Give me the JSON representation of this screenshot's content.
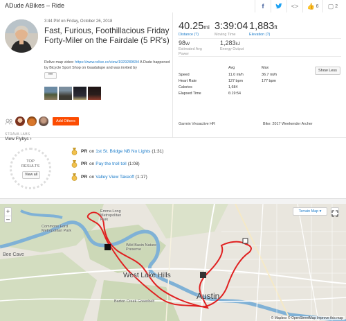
{
  "header": {
    "title": "ADude ABikes – Ride"
  },
  "share": {
    "kudos_count": "6",
    "comments_count": "2"
  },
  "activity": {
    "datetime": "3:44 PM on Friday, October 26, 2018",
    "title": "Fast, Furious, Foothillacious Friday Forty-Miler on the Fairdale (5 PR's)",
    "description_prefix": "Relive map video: ",
    "description_link": "https://www.relive.cc/view/1929289694",
    "description_suffix": " A Dude happened by Bicycle Sport Shop on Guadalupe and was invited by",
    "more_label": "•••",
    "add_others_label": "Add Others",
    "flyby_label": "STRAVA LABS",
    "flyby_link": "View Flybys"
  },
  "stats": {
    "distance": {
      "value": "40.25",
      "unit": "mi",
      "label": "Distance (?)"
    },
    "moving_time": {
      "value": "3:39:04",
      "label": "Moving Time"
    },
    "elevation": {
      "value": "1,883",
      "unit": "ft",
      "label": "Elevation (?)"
    },
    "power": {
      "value": "98",
      "unit": "W",
      "label": "Estimated Avg Power"
    },
    "energy": {
      "value": "1,283",
      "unit": "kJ",
      "label": "Energy Output"
    },
    "show_less_label": "Show Less",
    "table": {
      "col_avg": "Avg",
      "col_max": "Max",
      "rows": [
        {
          "label": "Speed",
          "avg": "11.0 mi/h",
          "max": "36.7 mi/h"
        },
        {
          "label": "Heart Rate",
          "avg": "127 bpm",
          "max": "177 bpm"
        },
        {
          "label": "Calories",
          "avg": "1,684",
          "max": ""
        },
        {
          "label": "Elapsed Time",
          "avg": "6:19:54",
          "max": ""
        }
      ]
    },
    "device": "Garmin Vivoactive HR",
    "bike": "Bike: 2017 Weekender Archer"
  },
  "results": {
    "label_line1": "TOP",
    "label_line2": "RESULTS",
    "view_all_label": "View all",
    "prs": [
      {
        "pr": "PR",
        "on": "on",
        "segment": "1st St. Bridge NB No Lights",
        "time": "(1:31)"
      },
      {
        "pr": "PR",
        "on": "on",
        "segment": "Pay the troll toll",
        "time": "(1:08)"
      },
      {
        "pr": "PR",
        "on": "on",
        "segment": "Valley View Takeoff",
        "time": "(1:17)"
      }
    ]
  },
  "map": {
    "terrain_label": "Terrain Map ▾",
    "zoom_in": "+",
    "zoom_out": "–",
    "attribution": "© Mapbox © OpenStreetMap Improve this map",
    "logo": "Mapbox",
    "places": [
      "Bee Cave",
      "West Lake Hills",
      "Austin",
      "Commons Ford Metropolitan Park",
      "Wild Basin Nature Preserve",
      "Emma Long Metropolitan Park",
      "Barton Creek Greenbelt"
    ],
    "route_color": "#e02020"
  }
}
